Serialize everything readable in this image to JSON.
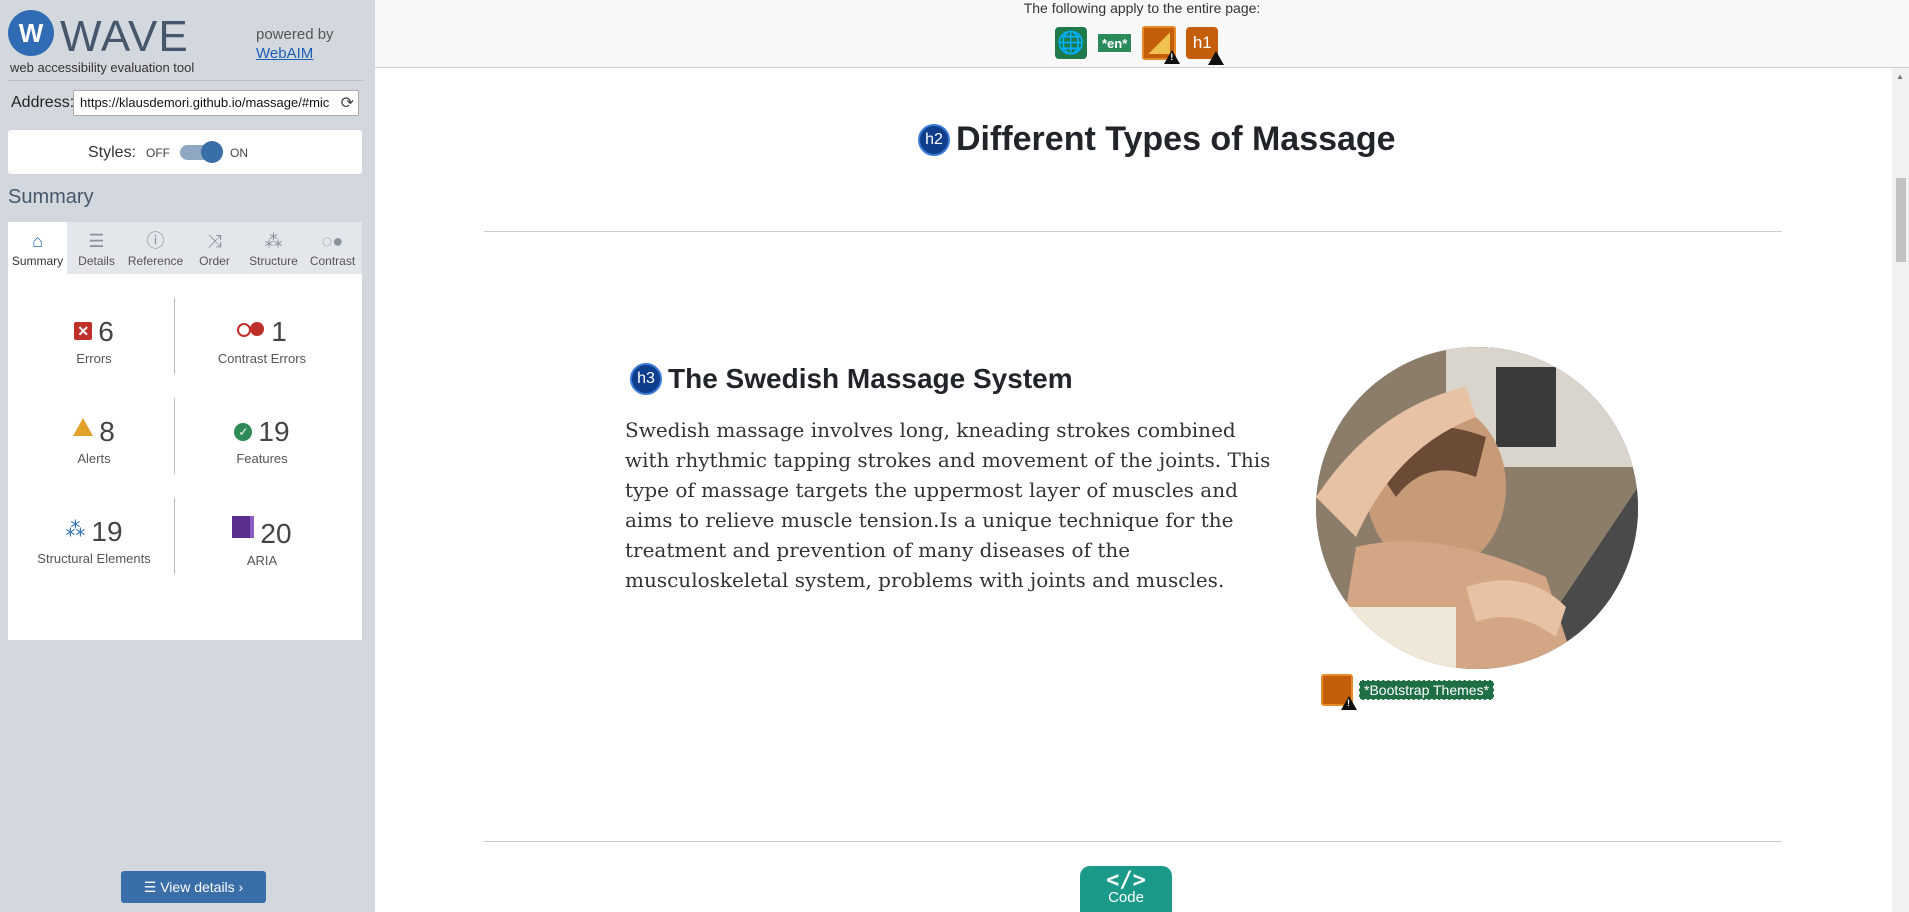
{
  "header": {
    "title": "WAVE",
    "subtitle": "web accessibility evaluation tool",
    "powered_by": "powered by",
    "powered_link": "WebAIM"
  },
  "address": {
    "label": "Address:",
    "value": "https://klausdemori.github.io/massage/#mic"
  },
  "styles": {
    "label": "Styles:",
    "off": "OFF",
    "on": "ON",
    "state": "on"
  },
  "summary_heading": "Summary",
  "tabs": [
    {
      "label": "Summary",
      "icon": "home-icon",
      "active": true
    },
    {
      "label": "Details",
      "icon": "list-icon"
    },
    {
      "label": "Reference",
      "icon": "info-icon"
    },
    {
      "label": "Order",
      "icon": "order-icon"
    },
    {
      "label": "Structure",
      "icon": "structure-icon"
    },
    {
      "label": "Contrast",
      "icon": "contrast-icon"
    }
  ],
  "stats": {
    "errors": {
      "count": "6",
      "label": "Errors"
    },
    "contrast_errors": {
      "count": "1",
      "label": "Contrast Errors"
    },
    "alerts": {
      "count": "8",
      "label": "Alerts"
    },
    "features": {
      "count": "19",
      "label": "Features"
    },
    "structural": {
      "count": "19",
      "label": "Structural Elements"
    },
    "aria": {
      "count": "20",
      "label": "ARIA"
    }
  },
  "view_details": "View details ›",
  "page_notice": "The following apply to the entire page:",
  "page_icons": {
    "lang": "🌐",
    "lang_badge": "*en*",
    "h1_badge": "h1"
  },
  "content": {
    "h2_badge": "h2",
    "h2": "Different Types of Massage",
    "h3_badge": "h3",
    "h3": "The Swedish Massage System",
    "paragraph": "Swedish massage involves long, kneading strokes combined with rhythmic tapping strokes and movement of the joints. This type of massage targets the uppermost layer of muscles and aims to relieve muscle tension.Is a unique technique for the treatment and prevention of many diseases of the musculoskeletal system, problems with joints and muscles.",
    "image_alt_badge": "*Bootstrap Themes*"
  },
  "code_button": {
    "icon": "</>",
    "label": "Code"
  },
  "colors": {
    "accent": "#3a6ea8",
    "error": "#c0302a",
    "alert": "#e0a22b",
    "feature": "#2e8b57",
    "aria": "#5b2d8e",
    "code_button": "#1b9a8a"
  }
}
